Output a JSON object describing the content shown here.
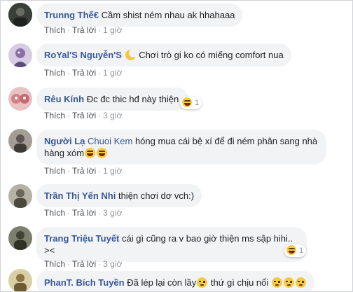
{
  "actions": {
    "like": "Thích",
    "reply": "Trả lời",
    "sep": "·"
  },
  "comments": [
    {
      "name": "Trunng Thế€",
      "text": "Cầm shist ném nhau ak hhahaaa",
      "time": "1 giờ"
    },
    {
      "name": "RoYal'S Nguyễn'S",
      "text": "Chơi trò gi ko có miếng comfort nua",
      "time": "1 giờ"
    },
    {
      "name": "Rêu Kính",
      "text": "Đc đc thic hđ này thiện",
      "time": "3 giờ",
      "reaction_count": "1"
    },
    {
      "name": "Người Lạ",
      "tag": "Chuoi Kem",
      "text": "hóng mua cái bệ xí để đi ném phân sang nhà hàng xóm",
      "time": "1 giờ"
    },
    {
      "name": "Trần Thị Yến Nhi",
      "text": "thiện chơi dơ vch:)",
      "time": "3 giờ"
    },
    {
      "name": "Trang Triệu Tuyết",
      "text": "cái gì cũng ra v bao giờ thiện ms sập hihi.. ><",
      "time": "3 giờ",
      "reaction_count": "1"
    },
    {
      "name": "PhanT. Bích Tuyền",
      "text": "Đã lép lại còn lầy",
      "text2": "thứ gì chịu nổi",
      "time": ""
    }
  ],
  "avatars": [
    {
      "icon": "avatar-photo",
      "color": "#2b2f2c"
    },
    {
      "icon": "avatar-photo",
      "color": "#b9a6c9"
    },
    {
      "icon": "avatar-photo",
      "color": "#c98a88"
    },
    {
      "icon": "avatar-photo",
      "color": "#7d776f"
    },
    {
      "icon": "avatar-photo",
      "color": "#8e8a7a"
    },
    {
      "icon": "avatar-photo",
      "color": "#5d6052"
    },
    {
      "icon": "avatar-photo",
      "color": "#9c8a5b"
    }
  ]
}
